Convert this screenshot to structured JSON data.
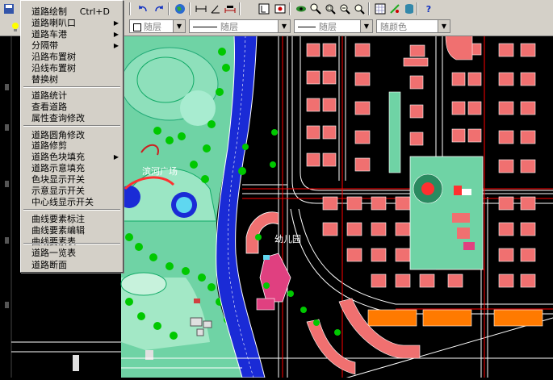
{
  "toolbar": {
    "buttons": [
      "undo-icon",
      "redo-icon",
      "globe-icon",
      "dimension-icon",
      "angle-icon",
      "measure-icon",
      "properties-icon",
      "snapshot-icon",
      "eye-icon",
      "zoom-realtime-icon",
      "zoom-window-icon",
      "zoom-prev-icon",
      "zoom-extents-icon",
      "grid-icon",
      "layers-icon",
      "database-icon",
      "help-icon"
    ],
    "help_label": "?"
  },
  "properties_bar": {
    "layer_label": "随层",
    "linetype_label": "随层",
    "lineweight_label": "随层",
    "color_label": "随颜色"
  },
  "menu": {
    "items": [
      {
        "label": "道路绘制",
        "shortcut": "Ctrl+D",
        "submenu": false
      },
      {
        "label": "道路喇叭口",
        "shortcut": "",
        "submenu": true
      },
      {
        "label": "道路车港",
        "shortcut": "",
        "submenu": true
      },
      {
        "label": "分隔带",
        "shortcut": "",
        "submenu": true
      },
      {
        "label": "沿路布置树",
        "shortcut": "",
        "submenu": false
      },
      {
        "label": "沿线布置树",
        "shortcut": "",
        "submenu": false
      },
      {
        "label": "替换树",
        "shortcut": "",
        "submenu": false
      },
      {
        "label": "道路统计",
        "shortcut": "",
        "submenu": false
      },
      {
        "label": "查看道路",
        "shortcut": "",
        "submenu": false
      },
      {
        "label": "属性查询修改",
        "shortcut": "",
        "submenu": false
      },
      {
        "label": "道路圆角修改",
        "shortcut": "",
        "submenu": false
      },
      {
        "label": "道路修剪",
        "shortcut": "",
        "submenu": false
      },
      {
        "label": "道路色块填充",
        "shortcut": "",
        "submenu": true
      },
      {
        "label": "道路示意填充",
        "shortcut": "",
        "submenu": false
      },
      {
        "label": "色块显示开关",
        "shortcut": "",
        "submenu": false
      },
      {
        "label": "示意显示开关",
        "shortcut": "",
        "submenu": false
      },
      {
        "label": "中心线显示开关",
        "shortcut": "",
        "submenu": false
      },
      {
        "label": "曲线要素标注",
        "shortcut": "",
        "submenu": false
      },
      {
        "label": "曲线要素编辑",
        "shortcut": "",
        "submenu": false
      },
      {
        "label": "曲线要素表",
        "shortcut": "",
        "submenu": false
      },
      {
        "label": "道路一览表",
        "shortcut": "",
        "submenu": false
      },
      {
        "label": "道路断面",
        "shortcut": "",
        "submenu": false
      }
    ]
  },
  "drawing": {
    "plaza_label": "滨河广场",
    "kindergarten_label": "幼儿园",
    "colors": {
      "background": "#000000",
      "park_green": "#6fd3a5",
      "river_blue": "#1a2bd6",
      "building_pink": "#f07070",
      "building_orange": "#ff7a00",
      "road_line": "#ffffff",
      "red_line": "#ff0000",
      "tree_green": "#00c800"
    }
  }
}
